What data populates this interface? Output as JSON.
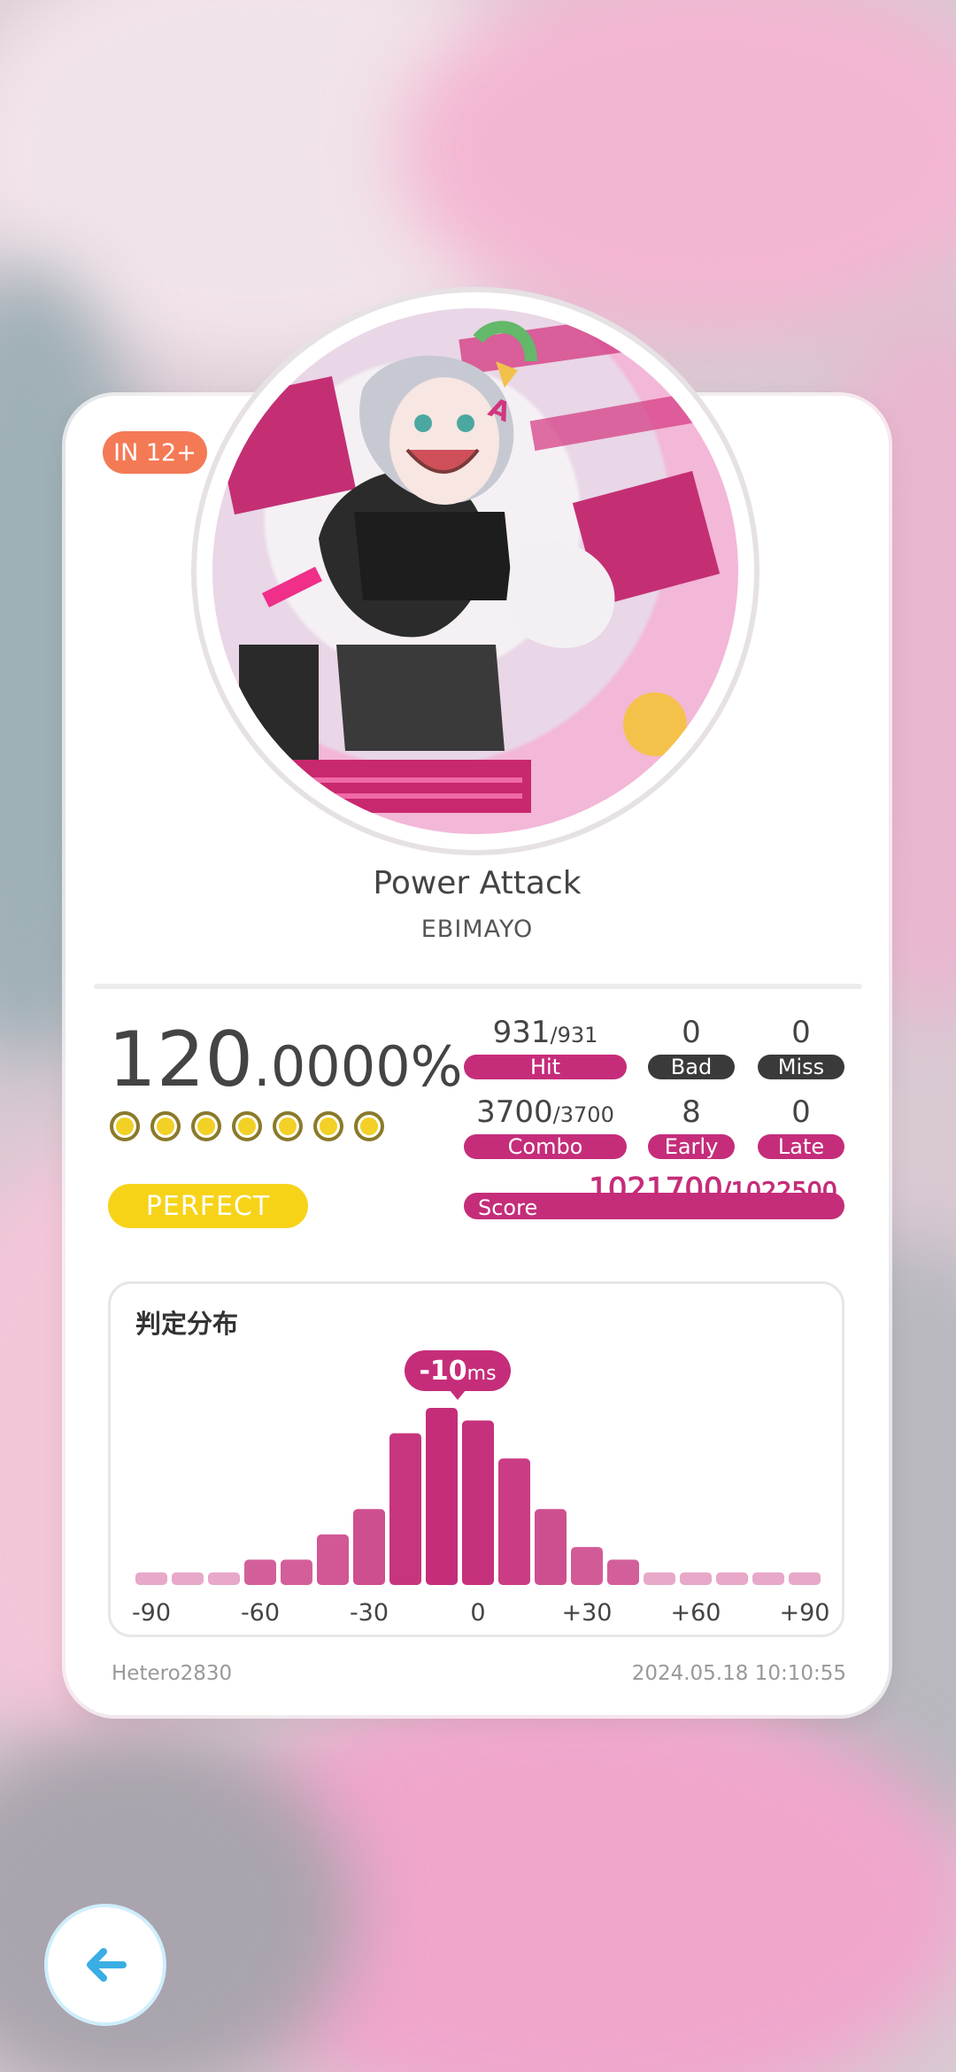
{
  "difficulty": {
    "label": "IN 12+",
    "color": "#f47a56"
  },
  "song": {
    "title": "Power Attack",
    "artist": "EBIMAYO"
  },
  "result": {
    "accuracy_int": "120",
    "accuracy_dec": ".0000%",
    "rank": "PERFECT",
    "rank_color": "#f7d318",
    "dots_count": 7
  },
  "stats": {
    "hit": {
      "value": "931",
      "total": "/931",
      "label": "Hit"
    },
    "bad": {
      "value": "0",
      "label": "Bad"
    },
    "miss": {
      "value": "0",
      "label": "Miss"
    },
    "combo": {
      "value": "3700",
      "total": "/3700",
      "label": "Combo"
    },
    "early": {
      "value": "8",
      "label": "Early"
    },
    "late": {
      "value": "0",
      "label": "Late"
    }
  },
  "score": {
    "label": "Score",
    "value": "1021700",
    "total": "/1022500"
  },
  "chart_data": {
    "type": "bar",
    "title": "判定分布",
    "categories": [
      "-90",
      "-80",
      "-70",
      "-60",
      "-50",
      "-40",
      "-30",
      "-20",
      "-10",
      "0",
      "+10",
      "+20",
      "+30",
      "+40",
      "+50",
      "+60",
      "+70",
      "+80",
      "+90"
    ],
    "values": [
      1,
      1,
      1,
      2,
      2,
      4,
      6,
      12,
      14,
      13,
      10,
      6,
      3,
      2,
      1,
      1,
      1,
      1,
      1
    ],
    "value_unit": "relative",
    "tick_labels": [
      "-90",
      "-60",
      "-30",
      "0",
      "+30",
      "+60",
      "+90"
    ],
    "annotation": {
      "value": "-10",
      "unit": "ms"
    },
    "bar_color": "#c52d7a",
    "bar_color_light": "#e8a8c8"
  },
  "footer": {
    "player": "Hetero2830",
    "date": "2024.05.18 10:10:55"
  },
  "back_button": {
    "icon": "arrow-left-icon",
    "color": "#3aaee4"
  }
}
